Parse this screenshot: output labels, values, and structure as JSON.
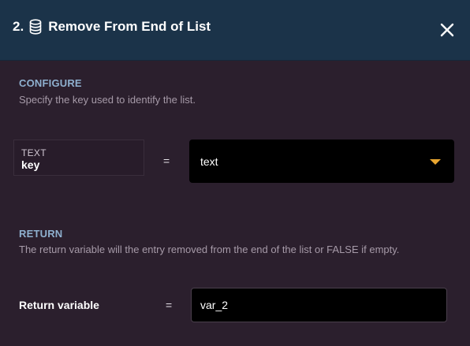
{
  "header": {
    "step_number": "2.",
    "title": "Remove From End of List",
    "title_icon": "database-icon",
    "close_icon": "close-icon"
  },
  "configure": {
    "heading": "CONFIGURE",
    "description": "Specify the key used to identify the list.",
    "param_type": "TEXT",
    "param_name": "key",
    "equals": "=",
    "selected_value": "text",
    "dropdown_icon": "caret-down-icon"
  },
  "return_section": {
    "heading": "RETURN",
    "description": "The return variable will the entry removed from the end of the list or FALSE if empty.",
    "label": "Return variable",
    "equals": "=",
    "value": "var_2"
  },
  "colors": {
    "header_bg": "#1b3349",
    "body_bg": "#2b1f2d",
    "section_heading": "#8fb0cf",
    "accent_caret": "#e9a630"
  }
}
